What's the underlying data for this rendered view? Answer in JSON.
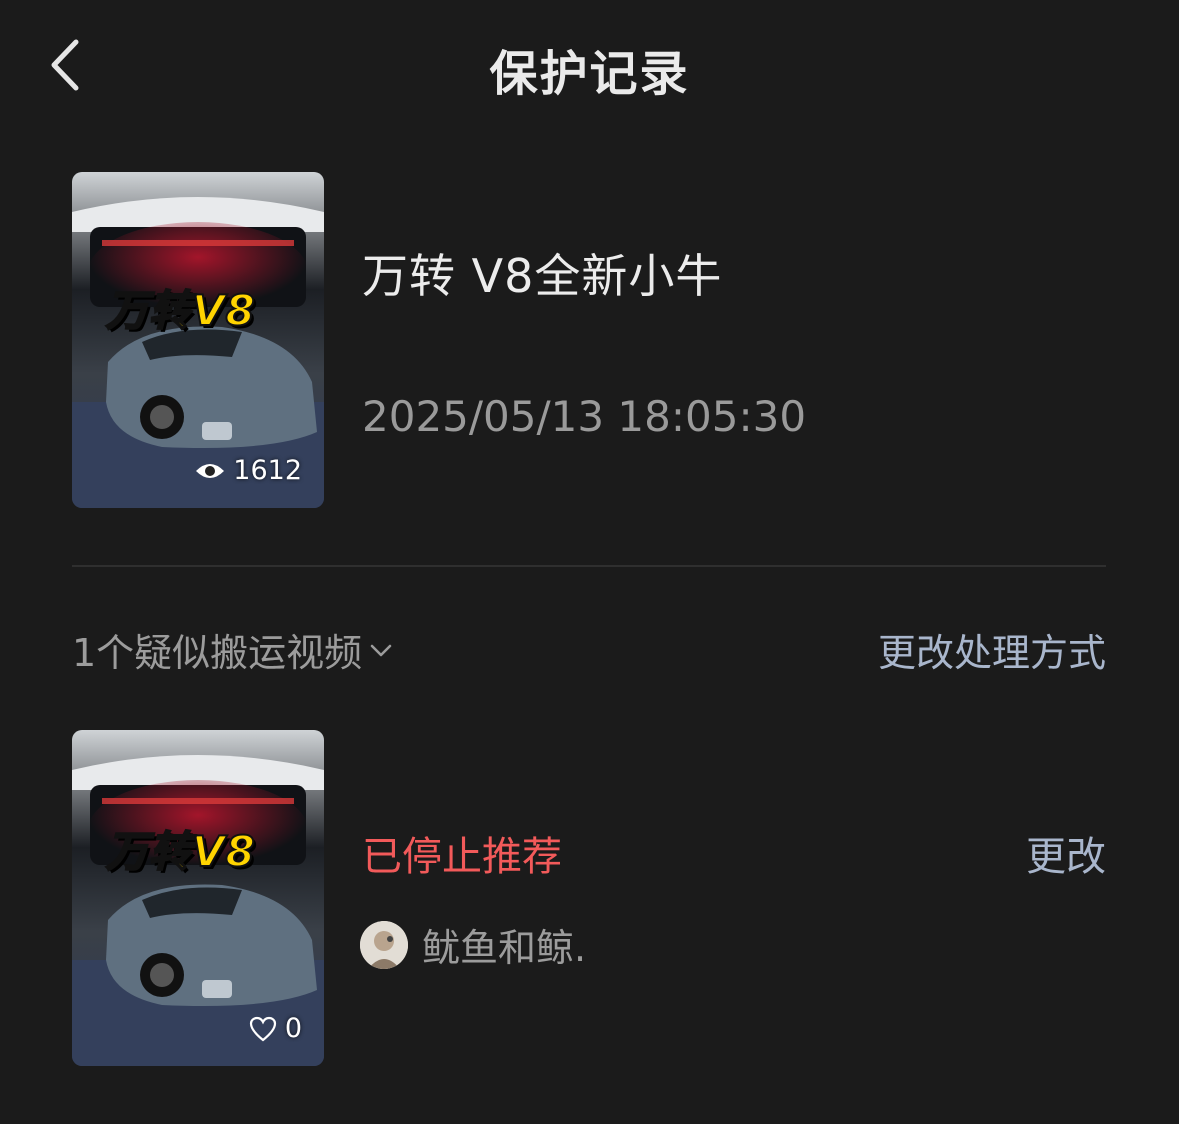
{
  "header": {
    "title": "保护记录",
    "back_icon": "chevron-left-icon"
  },
  "video": {
    "title": "万转 V8全新小牛",
    "timestamp": "2025/05/13 18:05:30",
    "thumbnail_text": "万转V8",
    "views": "1612",
    "views_icon": "eye-icon"
  },
  "section": {
    "summary": "1个疑似搬运视频",
    "summary_icon": "chevron-down-icon",
    "action": "更改处理方式"
  },
  "suspect": {
    "thumbnail_text": "万转V8",
    "likes": "0",
    "likes_icon": "heart-icon",
    "status": "已停止推荐",
    "status_color": "#f25a5a",
    "change_label": "更改",
    "username": "鱿鱼和鲸."
  },
  "colors": {
    "background": "#1b1b1b",
    "accent_link": "#a9b6cc",
    "warning": "#f25a5a"
  }
}
